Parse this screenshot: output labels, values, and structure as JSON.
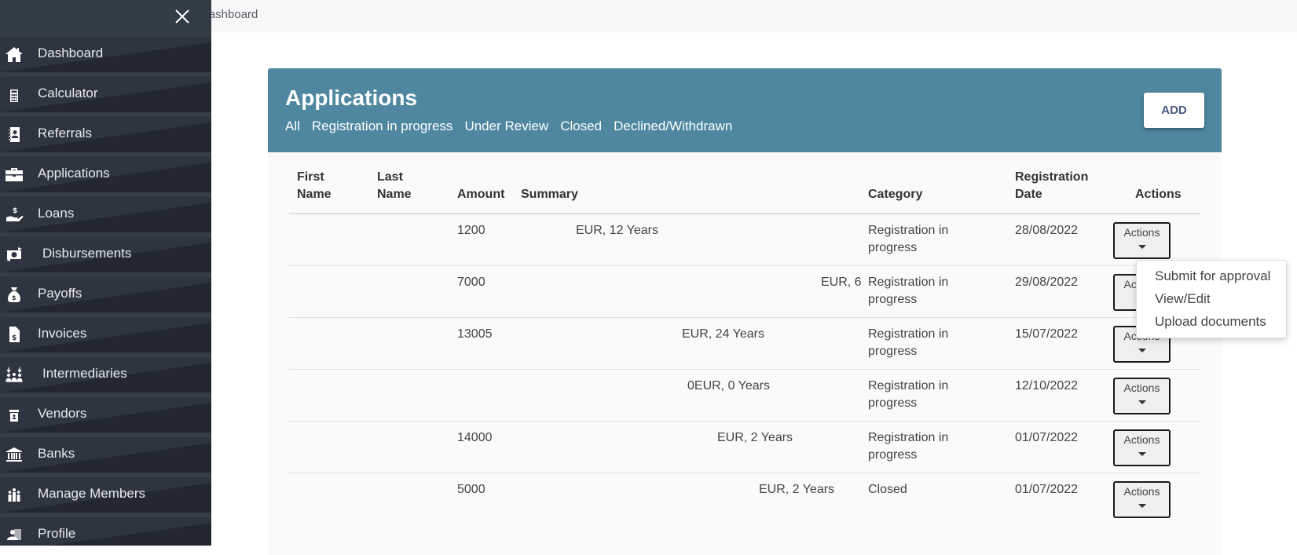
{
  "breadcrumb": {
    "current": "Dashboard"
  },
  "sidebar": {
    "items": [
      {
        "label": "Dashboard",
        "icon": "home-icon"
      },
      {
        "label": "Calculator",
        "icon": "calculator-icon"
      },
      {
        "label": "Referrals",
        "icon": "address-book-icon"
      },
      {
        "label": "Applications",
        "icon": "briefcase-icon"
      },
      {
        "label": "Loans",
        "icon": "hand-dollar-icon"
      },
      {
        "label": "Disbursements",
        "icon": "money-transfer-icon"
      },
      {
        "label": "Payoffs",
        "icon": "money-bag-icon"
      },
      {
        "label": "Invoices",
        "icon": "invoice-icon"
      },
      {
        "label": "Intermediaries",
        "icon": "people-arrows-icon"
      },
      {
        "label": "Vendors",
        "icon": "store-icon"
      },
      {
        "label": "Banks",
        "icon": "bank-icon"
      },
      {
        "label": "Manage Members",
        "icon": "group-icon"
      },
      {
        "label": "Profile",
        "icon": "profile-card-icon"
      }
    ]
  },
  "card": {
    "title": "Applications",
    "filters": [
      "All",
      "Registration in progress",
      "Under Review",
      "Closed",
      "Declined/Withdrawn"
    ],
    "add_label": "ADD"
  },
  "table": {
    "headers": {
      "first_name": [
        "First",
        "Name"
      ],
      "last_name": [
        "Last",
        "Name"
      ],
      "amount": "Amount",
      "summary": "Summary",
      "category": "Category",
      "registration_date": [
        "Registration",
        "Date"
      ],
      "actions": "Actions"
    },
    "rows": [
      {
        "first_name": "",
        "last_name": "",
        "amount": "1200",
        "summary": "EUR, 12 Years",
        "category": "Registration in progress",
        "date": "28/08/2022",
        "action_label": "Actions"
      },
      {
        "first_name": "",
        "last_name": "",
        "amount": "7000",
        "summary": "EUR, 6",
        "category": "Registration in progress",
        "date": "29/08/2022",
        "action_label": "Actions"
      },
      {
        "first_name": "",
        "last_name": "",
        "amount": "13005",
        "summary": "EUR, 24 Years",
        "category": "Registration in progress",
        "date": "15/07/2022",
        "action_label": "Actions"
      },
      {
        "first_name": "",
        "last_name": "",
        "amount": "",
        "summary": "0EUR, 0 Years",
        "category": "Registration in progress",
        "date": "12/10/2022",
        "action_label": "Actions"
      },
      {
        "first_name": "",
        "last_name": "",
        "amount": "14000",
        "summary": "EUR, 2 Years",
        "category": "Registration in progress",
        "date": "01/07/2022",
        "action_label": "Actions"
      },
      {
        "first_name": "",
        "last_name": "",
        "amount": "5000",
        "summary": "EUR, 2 Years",
        "category": "Closed",
        "date": "01/07/2022",
        "action_label": "Actions"
      }
    ]
  },
  "dropdown": {
    "items": [
      "Submit for approval",
      "View/Edit",
      "Upload documents"
    ]
  }
}
